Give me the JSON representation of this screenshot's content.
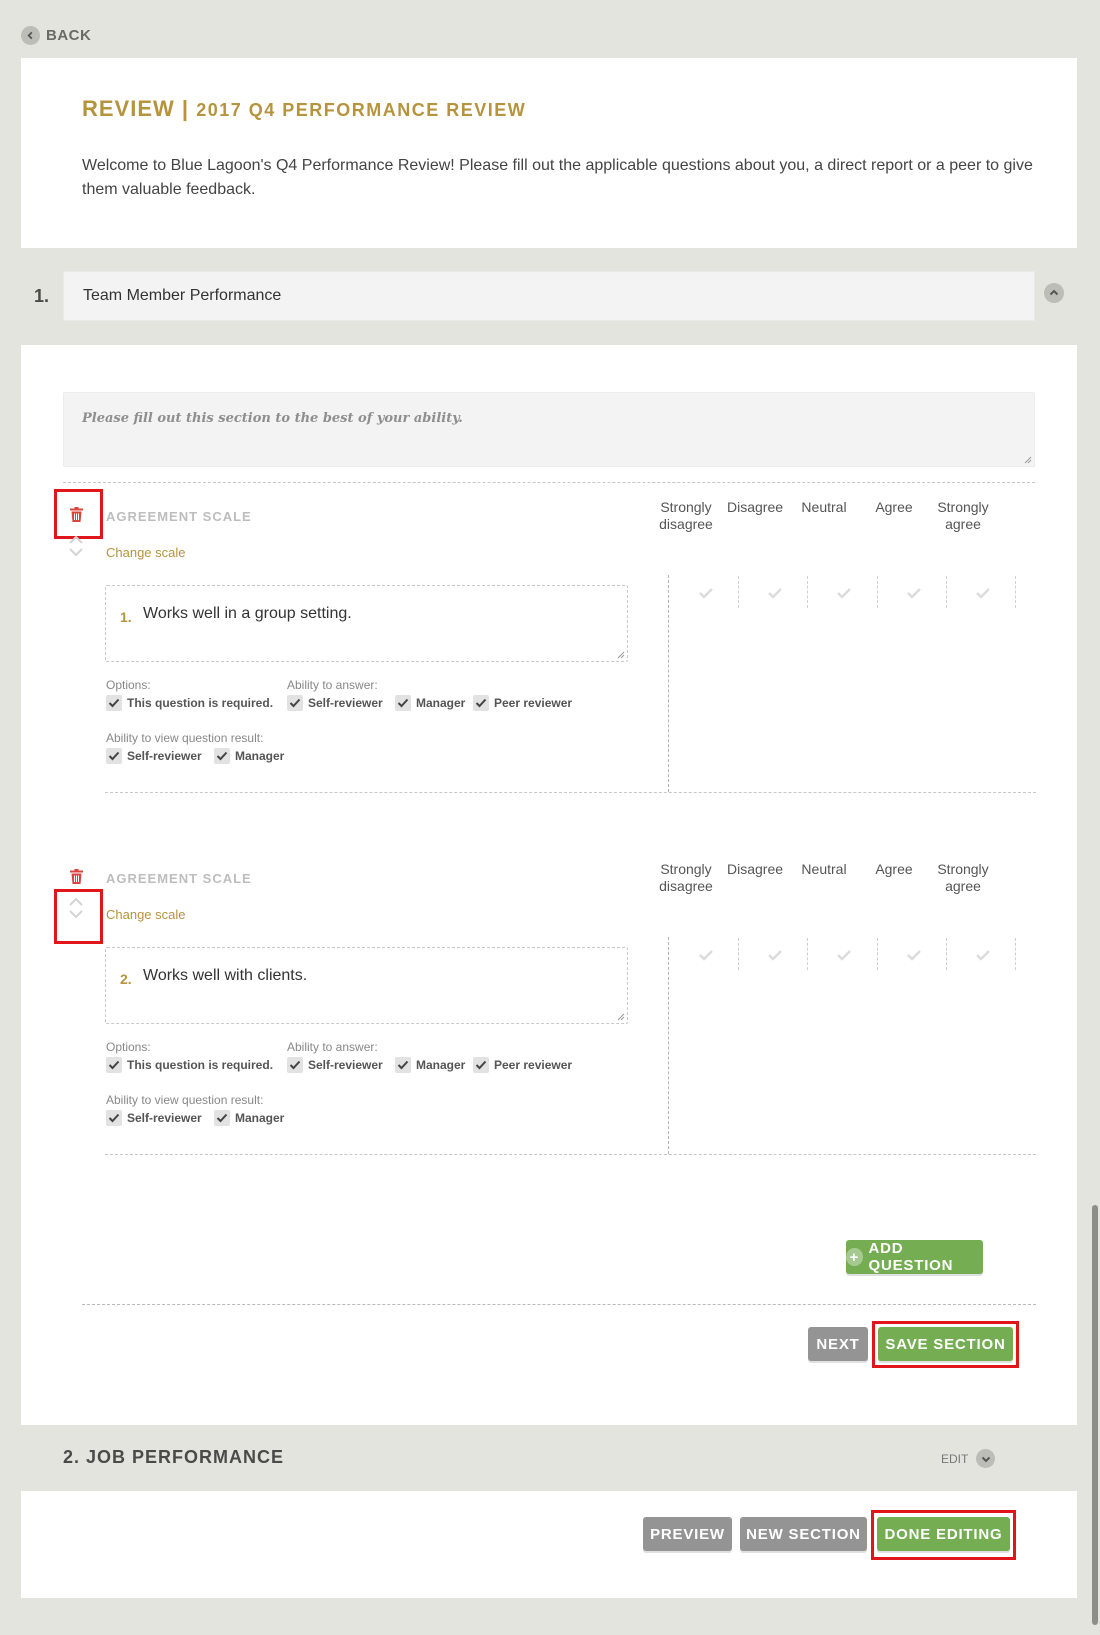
{
  "nav": {
    "back_label": "BACK"
  },
  "review": {
    "title_prefix": "REVIEW |",
    "title_name": "2017 Q4 PERFORMANCE REVIEW",
    "intro": "Welcome to Blue Lagoon's Q4 Performance Review! Please fill out the applicable questions about you, a direct report or a peer to give them valuable feedback."
  },
  "section1": {
    "number": "1.",
    "title": "Team Member Performance",
    "description_placeholder": "Please fill out this section to the best of your ability."
  },
  "scale": {
    "label": "AGREEMENT SCALE",
    "change_label": "Change scale",
    "headers": [
      "Strongly disagree",
      "Disagree",
      "Neutral",
      "Agree",
      "Strongly agree"
    ]
  },
  "options": {
    "options_label": "Options:",
    "required_label": "This question is required.",
    "answer_label": "Ability to answer:",
    "self_reviewer": "Self-reviewer",
    "manager": "Manager",
    "peer_reviewer": "Peer reviewer",
    "view_label": "Ability to view question result:"
  },
  "questions": [
    {
      "number": "1.",
      "text": "Works well in a group setting."
    },
    {
      "number": "2.",
      "text": "Works well with clients."
    }
  ],
  "buttons": {
    "add_question": "ADD QUESTION",
    "next": "NEXT",
    "save_section": "SAVE SECTION",
    "preview": "PREVIEW",
    "new_section": "NEW SECTION",
    "done_editing": "DONE EDITING"
  },
  "section2": {
    "title": "2. JOB PERFORMANCE",
    "edit_label": "EDIT"
  },
  "colors": {
    "accent_gold": "#b5943d",
    "green": "#75ad52",
    "gray_button": "#949494",
    "highlight_red": "#e0161b",
    "trash_red": "#d9453d"
  },
  "icons": [
    "chevron-left-icon",
    "chevron-up-icon",
    "chevron-down-icon",
    "trash-icon",
    "check-icon",
    "plus-icon"
  ]
}
